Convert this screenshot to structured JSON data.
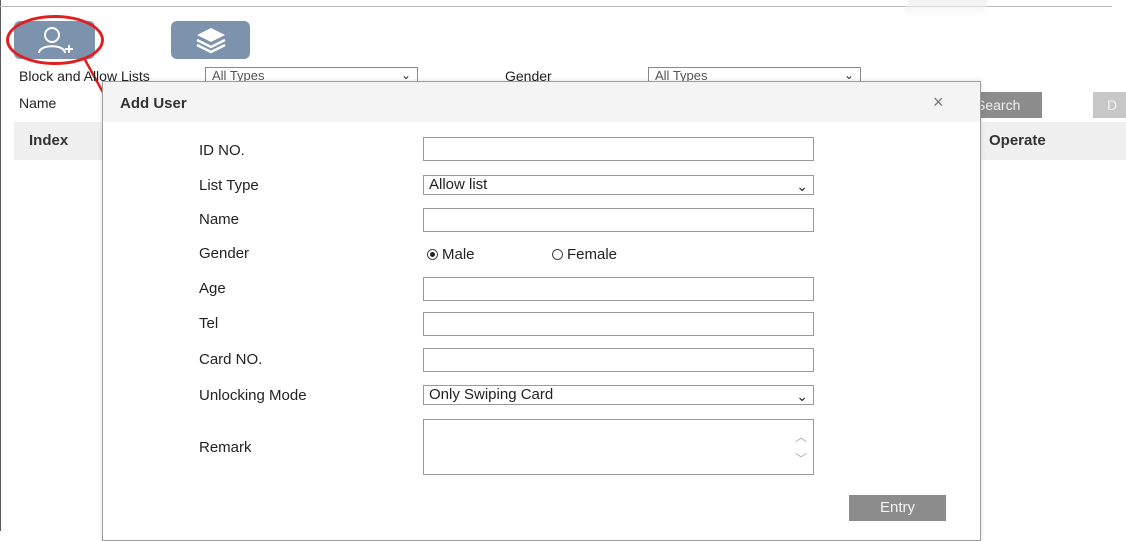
{
  "toolbar": {
    "add_user_icon": "add-user-icon",
    "layers_icon": "layers-icon"
  },
  "filters": {
    "list_label": "Block and Allow Lists",
    "list_value": "All Types",
    "gender_label": "Gender",
    "gender_value": "All Types",
    "name_label": "Name",
    "search_label": "Search",
    "delete_label": "D"
  },
  "table": {
    "columns": [
      "Index",
      "Operate"
    ]
  },
  "modal": {
    "title": "Add User",
    "close": "×",
    "fields": {
      "id_label": "ID NO.",
      "list_type_label": "List Type",
      "list_type_value": "Allow list",
      "name_label": "Name",
      "gender_label": "Gender",
      "gender_male": "Male",
      "gender_female": "Female",
      "gender_selected": "Male",
      "age_label": "Age",
      "tel_label": "Tel",
      "card_label": "Card NO.",
      "unlock_label": "Unlocking Mode",
      "unlock_value": "Only Swiping Card",
      "remark_label": "Remark"
    },
    "entry_button": "Entry"
  },
  "colors": {
    "toolbar_button": "#7d92ac",
    "highlight": "#e02020",
    "action_button": "#8c8c8c"
  }
}
